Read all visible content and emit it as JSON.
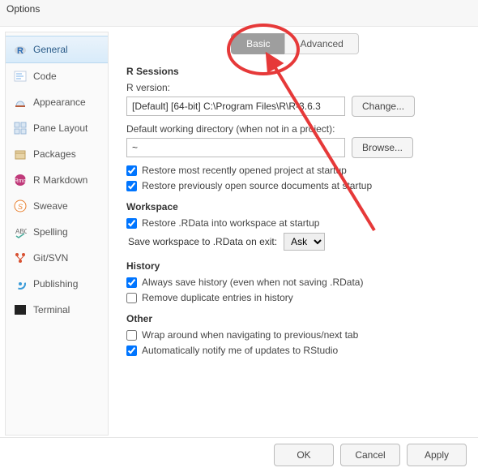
{
  "window": {
    "title": "Options"
  },
  "sidebar": {
    "items": [
      {
        "label": "General"
      },
      {
        "label": "Code"
      },
      {
        "label": "Appearance"
      },
      {
        "label": "Pane Layout"
      },
      {
        "label": "Packages"
      },
      {
        "label": "R Markdown"
      },
      {
        "label": "Sweave"
      },
      {
        "label": "Spelling"
      },
      {
        "label": "Git/SVN"
      },
      {
        "label": "Publishing"
      },
      {
        "label": "Terminal"
      }
    ]
  },
  "tabs": {
    "basic": "Basic",
    "advanced": "Advanced"
  },
  "sections": {
    "r_sessions": {
      "title": "R Sessions",
      "r_version_label": "R version:",
      "r_version_value": "[Default] [64-bit] C:\\Program Files\\R\\R-3.6.3",
      "change_btn": "Change...",
      "wd_label": "Default working directory (when not in a project):",
      "wd_value": "~",
      "browse_btn": "Browse...",
      "restore_project": "Restore most recently opened project at startup",
      "restore_docs": "Restore previously open source documents at startup"
    },
    "workspace": {
      "title": "Workspace",
      "restore_rdata": "Restore .RData into workspace at startup",
      "save_label": "Save workspace to .RData on exit:",
      "save_value": "Ask"
    },
    "history": {
      "title": "History",
      "always_save": "Always save history (even when not saving .RData)",
      "remove_dup": "Remove duplicate entries in history"
    },
    "other": {
      "title": "Other",
      "wrap_tabs": "Wrap around when navigating to previous/next tab",
      "auto_notify": "Automatically notify me of updates to RStudio"
    }
  },
  "footer": {
    "ok": "OK",
    "cancel": "Cancel",
    "apply": "Apply"
  },
  "colors": {
    "annotation": "#e63939"
  }
}
